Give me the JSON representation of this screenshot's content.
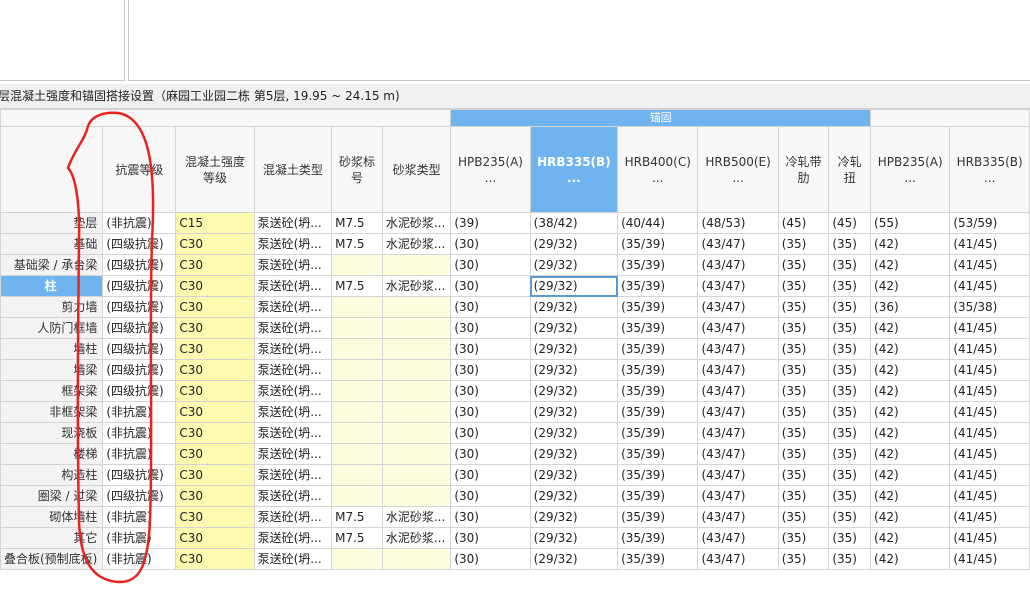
{
  "title": "层混凝土强度和锚固搭接设置（麻园工业园二栋 第5层, 19.95 ~ 24.15 m)",
  "group_header": "锚固",
  "columns": {
    "seismic": "抗震等级",
    "concrete_grade": "混凝土强度等级",
    "concrete_type": "混凝土类型",
    "mortar_grade": "砂浆标号",
    "mortar_type": "砂浆类型",
    "hpb235": "HPB235(A)\n...",
    "hrb335": "HRB335(B)\n...",
    "hrb400": "HRB400(C)\n...",
    "hrb500": "HRB500(E)\n...",
    "cold_ribbed": "冷轧带肋",
    "cold_twisted": "冷轧扭",
    "hpb235_2": "HPB235(A)\n...",
    "hrb335_2": "HRB335(B)\n..."
  },
  "rows": [
    {
      "name": "垫层",
      "seismic": "(非抗震)",
      "grade": "C15",
      "type": "泵送砼(坍...",
      "mortar_grade": "M7.5",
      "mortar_type": "水泥砂浆...",
      "a1": "(39)",
      "a2": "(38/42)",
      "a3": "(40/44)",
      "a4": "(48/53)",
      "a5": "(45)",
      "a6": "(45)",
      "a7": "(55)",
      "a8": "(53/59)"
    },
    {
      "name": "基础",
      "seismic": "(四级抗震)",
      "grade": "C30",
      "type": "泵送砼(坍...",
      "mortar_grade": "M7.5",
      "mortar_type": "水泥砂浆...",
      "a1": "(30)",
      "a2": "(29/32)",
      "a3": "(35/39)",
      "a4": "(43/47)",
      "a5": "(35)",
      "a6": "(35)",
      "a7": "(42)",
      "a8": "(41/45)"
    },
    {
      "name": "基础梁 / 承台梁",
      "seismic": "(四级抗震)",
      "grade": "C30",
      "type": "泵送砼(坍...",
      "mortar_grade": "",
      "mortar_type": "",
      "a1": "(30)",
      "a2": "(29/32)",
      "a3": "(35/39)",
      "a4": "(43/47)",
      "a5": "(35)",
      "a6": "(35)",
      "a7": "(42)",
      "a8": "(41/45)"
    },
    {
      "name": "柱",
      "seismic": "(四级抗震)",
      "grade": "C30",
      "type": "泵送砼(坍...",
      "mortar_grade": "M7.5",
      "mortar_type": "水泥砂浆...",
      "a1": "(30)",
      "a2": "(29/32)",
      "a3": "(35/39)",
      "a4": "(43/47)",
      "a5": "(35)",
      "a6": "(35)",
      "a7": "(42)",
      "a8": "(41/45)"
    },
    {
      "name": "剪力墙",
      "seismic": "(四级抗震)",
      "grade": "C30",
      "type": "泵送砼(坍...",
      "mortar_grade": "",
      "mortar_type": "",
      "a1": "(30)",
      "a2": "(29/32)",
      "a3": "(35/39)",
      "a4": "(43/47)",
      "a5": "(35)",
      "a6": "(35)",
      "a7": "(36)",
      "a8": "(35/38)"
    },
    {
      "name": "人防门框墙",
      "seismic": "(四级抗震)",
      "grade": "C30",
      "type": "泵送砼(坍...",
      "mortar_grade": "",
      "mortar_type": "",
      "a1": "(30)",
      "a2": "(29/32)",
      "a3": "(35/39)",
      "a4": "(43/47)",
      "a5": "(35)",
      "a6": "(35)",
      "a7": "(42)",
      "a8": "(41/45)"
    },
    {
      "name": "墙柱",
      "seismic": "(四级抗震)",
      "grade": "C30",
      "type": "泵送砼(坍...",
      "mortar_grade": "",
      "mortar_type": "",
      "a1": "(30)",
      "a2": "(29/32)",
      "a3": "(35/39)",
      "a4": "(43/47)",
      "a5": "(35)",
      "a6": "(35)",
      "a7": "(42)",
      "a8": "(41/45)"
    },
    {
      "name": "墙梁",
      "seismic": "(四级抗震)",
      "grade": "C30",
      "type": "泵送砼(坍...",
      "mortar_grade": "",
      "mortar_type": "",
      "a1": "(30)",
      "a2": "(29/32)",
      "a3": "(35/39)",
      "a4": "(43/47)",
      "a5": "(35)",
      "a6": "(35)",
      "a7": "(42)",
      "a8": "(41/45)"
    },
    {
      "name": "框架梁",
      "seismic": "(四级抗震)",
      "grade": "C30",
      "type": "泵送砼(坍...",
      "mortar_grade": "",
      "mortar_type": "",
      "a1": "(30)",
      "a2": "(29/32)",
      "a3": "(35/39)",
      "a4": "(43/47)",
      "a5": "(35)",
      "a6": "(35)",
      "a7": "(42)",
      "a8": "(41/45)"
    },
    {
      "name": "非框架梁",
      "seismic": "(非抗震)",
      "grade": "C30",
      "type": "泵送砼(坍...",
      "mortar_grade": "",
      "mortar_type": "",
      "a1": "(30)",
      "a2": "(29/32)",
      "a3": "(35/39)",
      "a4": "(43/47)",
      "a5": "(35)",
      "a6": "(35)",
      "a7": "(42)",
      "a8": "(41/45)"
    },
    {
      "name": "现浇板",
      "seismic": "(非抗震)",
      "grade": "C30",
      "type": "泵送砼(坍...",
      "mortar_grade": "",
      "mortar_type": "",
      "a1": "(30)",
      "a2": "(29/32)",
      "a3": "(35/39)",
      "a4": "(43/47)",
      "a5": "(35)",
      "a6": "(35)",
      "a7": "(42)",
      "a8": "(41/45)"
    },
    {
      "name": "楼梯",
      "seismic": "(非抗震)",
      "grade": "C30",
      "type": "泵送砼(坍...",
      "mortar_grade": "",
      "mortar_type": "",
      "a1": "(30)",
      "a2": "(29/32)",
      "a3": "(35/39)",
      "a4": "(43/47)",
      "a5": "(35)",
      "a6": "(35)",
      "a7": "(42)",
      "a8": "(41/45)"
    },
    {
      "name": "构造柱",
      "seismic": "(四级抗震)",
      "grade": "C30",
      "type": "泵送砼(坍...",
      "mortar_grade": "",
      "mortar_type": "",
      "a1": "(30)",
      "a2": "(29/32)",
      "a3": "(35/39)",
      "a4": "(43/47)",
      "a5": "(35)",
      "a6": "(35)",
      "a7": "(42)",
      "a8": "(41/45)"
    },
    {
      "name": "圈梁 / 过梁",
      "seismic": "(四级抗震)",
      "grade": "C30",
      "type": "泵送砼(坍...",
      "mortar_grade": "",
      "mortar_type": "",
      "a1": "(30)",
      "a2": "(29/32)",
      "a3": "(35/39)",
      "a4": "(43/47)",
      "a5": "(35)",
      "a6": "(35)",
      "a7": "(42)",
      "a8": "(41/45)"
    },
    {
      "name": "砌体墙柱",
      "seismic": "(非抗震)",
      "grade": "C30",
      "type": "泵送砼(坍...",
      "mortar_grade": "M7.5",
      "mortar_type": "水泥砂浆...",
      "a1": "(30)",
      "a2": "(29/32)",
      "a3": "(35/39)",
      "a4": "(43/47)",
      "a5": "(35)",
      "a6": "(35)",
      "a7": "(42)",
      "a8": "(41/45)"
    },
    {
      "name": "其它",
      "seismic": "(非抗震)",
      "grade": "C30",
      "type": "泵送砼(坍...",
      "mortar_grade": "M7.5",
      "mortar_type": "水泥砂浆...",
      "a1": "(30)",
      "a2": "(29/32)",
      "a3": "(35/39)",
      "a4": "(43/47)",
      "a5": "(35)",
      "a6": "(35)",
      "a7": "(42)",
      "a8": "(41/45)"
    },
    {
      "name": "叠合板(预制底板)",
      "seismic": "(非抗震)",
      "grade": "C30",
      "type": "泵送砼(坍...",
      "mortar_grade": "",
      "mortar_type": "",
      "a1": "(30)",
      "a2": "(29/32)",
      "a3": "(35/39)",
      "a4": "(43/47)",
      "a5": "(35)",
      "a6": "(35)",
      "a7": "(42)",
      "a8": "(41/45)"
    }
  ],
  "selected_row": 3,
  "colors": {
    "accent": "#6fb3ef",
    "yellow": "#fdfbb0",
    "annotation": "#e8231f"
  }
}
